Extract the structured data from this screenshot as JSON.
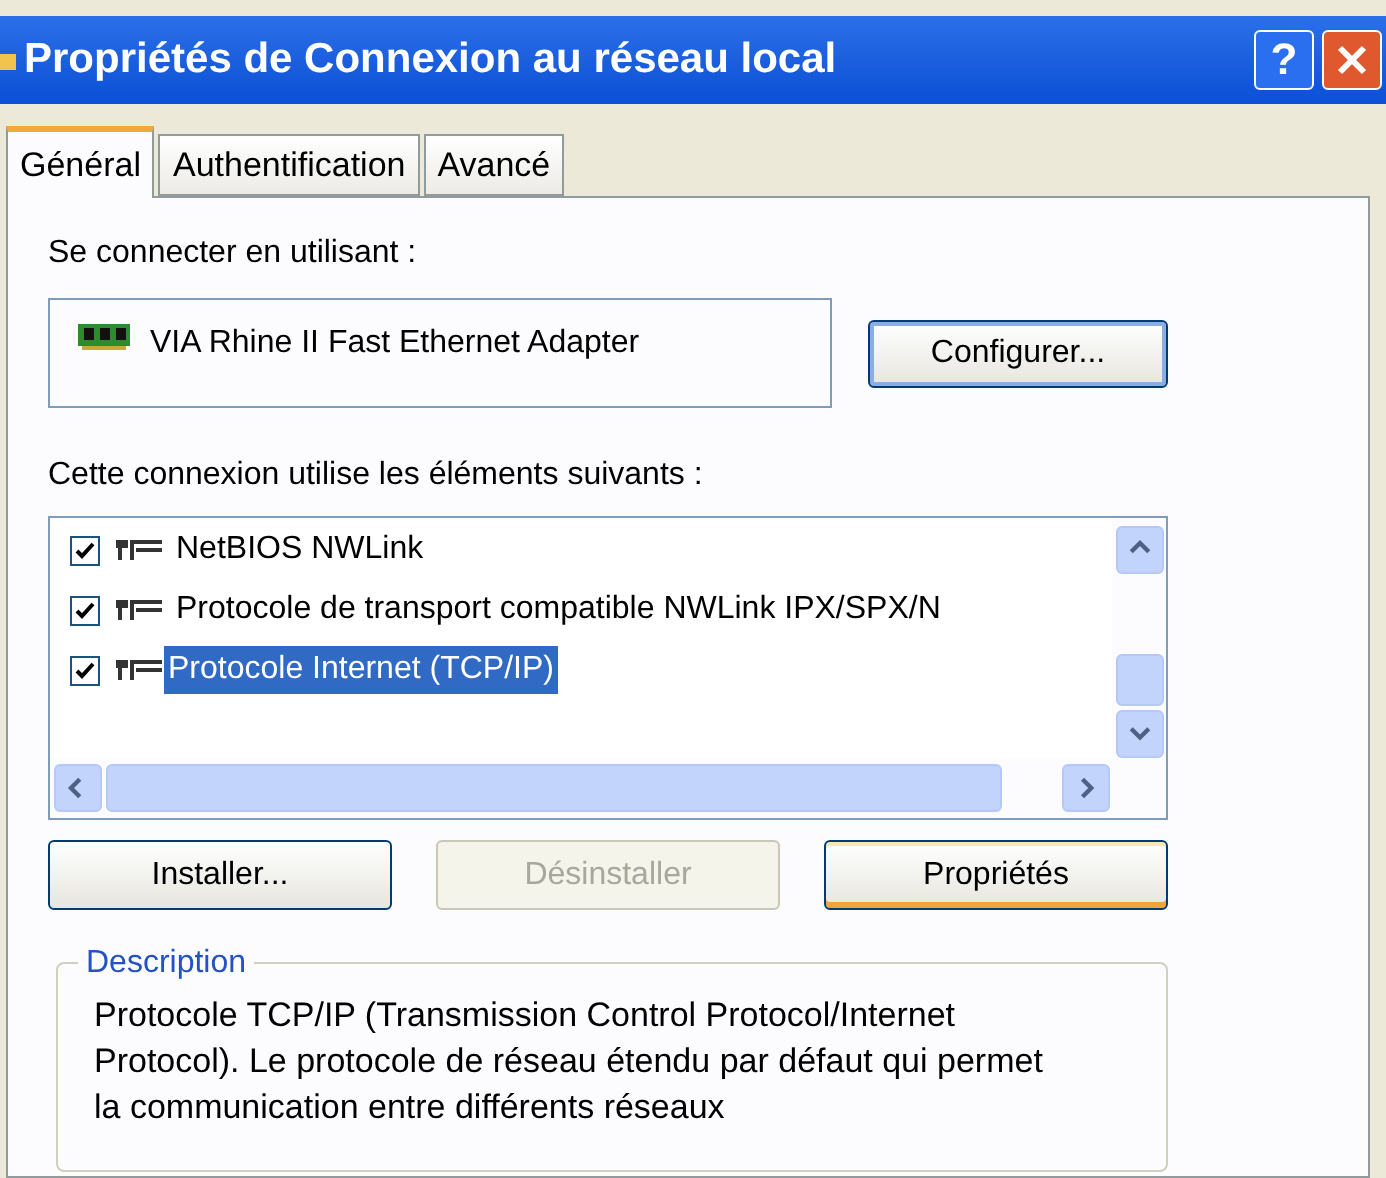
{
  "window": {
    "title": "Propriétés de Connexion au réseau local",
    "help_button": "?"
  },
  "tabs": [
    {
      "label": "Général",
      "selected": true
    },
    {
      "label": "Authentification",
      "selected": false
    },
    {
      "label": "Avancé",
      "selected": false
    }
  ],
  "connect_using": {
    "label": "Se connecter en utilisant :",
    "adapter": "VIA Rhine II Fast Ethernet Adapter",
    "configure_button": "Configurer..."
  },
  "components": {
    "label": "Cette connexion utilise les éléments suivants :",
    "items": [
      {
        "label": "NetBIOS NWLink",
        "checked": true,
        "selected": false
      },
      {
        "label": "Protocole de transport compatible NWLink IPX/SPX/N",
        "checked": true,
        "selected": false
      },
      {
        "label": "Protocole Internet (TCP/IP)",
        "checked": true,
        "selected": true
      }
    ]
  },
  "buttons": [
    {
      "label": "Installer...",
      "disabled": false,
      "default": false
    },
    {
      "label": "Désinstaller",
      "disabled": true,
      "default": false
    },
    {
      "label": "Propriétés",
      "disabled": false,
      "default": true
    }
  ],
  "description": {
    "legend": "Description",
    "text": "Protocole TCP/IP (Transmission Control Protocol/Internet Protocol). Le protocole de réseau étendu par défaut qui permet la communication entre différents réseaux"
  }
}
